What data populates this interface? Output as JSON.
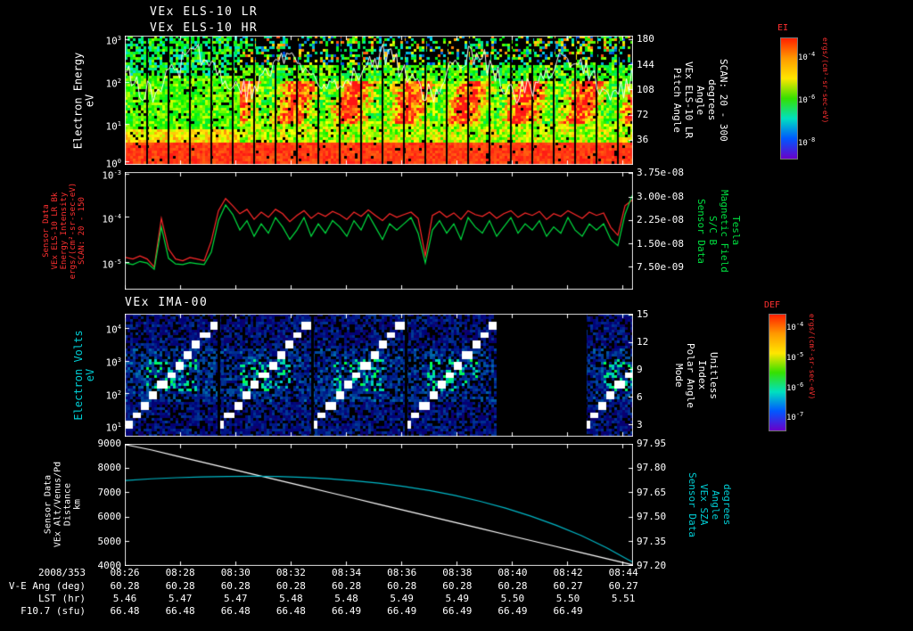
{
  "colors": {
    "bg": "#000000",
    "frame": "#dedede",
    "red": "#ff2a2a",
    "green": "#00e040",
    "cyan": "#00cdd4",
    "white": "#ffffff"
  },
  "time_axis": {
    "date": "2008/353",
    "labels": [
      "08:26",
      "08:28",
      "08:30",
      "08:32",
      "08:34",
      "08:36",
      "08:38",
      "08:40",
      "08:42",
      "08:44"
    ]
  },
  "ephemeris_rows": [
    {
      "label": "V-E Ang (deg)",
      "values": [
        "60.28",
        "60.28",
        "60.28",
        "60.28",
        "60.28",
        "60.28",
        "60.28",
        "60.28",
        "60.27",
        "60.27"
      ]
    },
    {
      "label": "LST (hr)",
      "values": [
        "5.46",
        "5.47",
        "5.47",
        "5.48",
        "5.48",
        "5.49",
        "5.49",
        "5.50",
        "5.50",
        "5.51"
      ]
    },
    {
      "label": "F10.7 (sfu)",
      "values": [
        "66.48",
        "66.48",
        "66.48",
        "66.48",
        "66.49",
        "66.49",
        "66.49",
        "66.49",
        "66.49"
      ]
    }
  ],
  "chart_data": [
    {
      "id": "els",
      "type": "heatmap",
      "titles": [
        "VEx ELS-10 LR",
        "VEx ELS-10 HR"
      ],
      "ylabel_left": [
        "Electron Energy",
        "eV"
      ],
      "ylabel_left_color": "#ffffff",
      "left_ticks": [
        {
          "label": "10^3",
          "f": 0.03
        },
        {
          "label": "10^2",
          "f": 0.36
        },
        {
          "label": "10^1",
          "f": 0.69
        },
        {
          "label": "10^0",
          "f": 0.98
        }
      ],
      "right_ticks": [
        {
          "label": "180",
          "f": 0.03
        },
        {
          "label": "144",
          "f": 0.225
        },
        {
          "label": "108",
          "f": 0.42
        },
        {
          "label": "72",
          "f": 0.615
        },
        {
          "label": "36",
          "f": 0.81
        }
      ],
      "ylabel_right": [
        "Pitch Angle",
        "VEx ELS-10 LR",
        "Angle",
        "degrees",
        "SCAN: 20 - 300"
      ],
      "ylabel_right_color": "#ffffff",
      "colorbar": {
        "label": "EI",
        "label_color": "#ff3030",
        "units": "ergs/(cm²-sr-sec-eV)",
        "units_color": "#ff3030",
        "ticks": [
          {
            "label": "10^-4",
            "f": 0.15
          },
          {
            "label": "10^-6",
            "f": 0.5
          },
          {
            "label": "10^-8",
            "f": 0.86
          }
        ],
        "gradient": [
          "#ff2000",
          "#ff9a00",
          "#ffe600",
          "#35e000",
          "#00e0c0",
          "#0058ff",
          "#6a00c8"
        ]
      },
      "content": {
        "kind": "els-spectrogram",
        "shock_frac": 0.225,
        "segments": 24,
        "overlay": "pitch-angle-trace",
        "overlay_color": "#ffffff"
      }
    },
    {
      "id": "intensity-bfield",
      "type": "line",
      "ylabel_left": [
        "Sensor Data",
        "VEx ELS-10 LR Bk",
        "Energy Intensity",
        "ergs/(cm²-sr-sec-eV)",
        "SCAN: 20 - 150"
      ],
      "ylabel_left_color": "#ff3030",
      "left_ticks": [
        {
          "label": "10^-3",
          "f": 0.015
        },
        {
          "label": "10^-4",
          "f": 0.385
        },
        {
          "label": "10^-5",
          "f": 0.77
        }
      ],
      "right_ticks": [
        {
          "label": "3.75e-08",
          "f": 0.01
        },
        {
          "label": "3.00e-08",
          "f": 0.21
        },
        {
          "label": "2.25e-08",
          "f": 0.41
        },
        {
          "label": "1.50e-08",
          "f": 0.61
        },
        {
          "label": "7.50e-09",
          "f": 0.81
        }
      ],
      "ylabel_right": [
        "Sensor Data",
        "S/C B",
        "Magnetic Field",
        "Tesla"
      ],
      "ylabel_right_color": "#00e040",
      "series": [
        {
          "name": "ELS energy intensity",
          "color": "#ff2a2a",
          "axis": "log-left",
          "axis_range": {
            "top": 0.001,
            "decade_frac": 0.385
          },
          "scale": 1e-06,
          "values": [
            13,
            12,
            14,
            12,
            8,
            95,
            20,
            12,
            11,
            13,
            12,
            11,
            30,
            140,
            260,
            180,
            120,
            150,
            90,
            130,
            100,
            150,
            120,
            80,
            110,
            140,
            95,
            125,
            105,
            135,
            115,
            90,
            130,
            105,
            145,
            110,
            85,
            120,
            100,
            115,
            130,
            95,
            14,
            110,
            135,
            100,
            125,
            90,
            140,
            115,
            105,
            130,
            95,
            120,
            140,
            100,
            125,
            110,
            135,
            90,
            120,
            105,
            140,
            115,
            95,
            130,
            110,
            125,
            60,
            40,
            180,
            240
          ]
        },
        {
          "name": "S/C B magnetic field",
          "color": "#00e040",
          "axis": "linear-right",
          "axis_range": {
            "top": 3.75e-08,
            "bottom": 0
          },
          "scale": 1e-09,
          "values": [
            8.5,
            8,
            9,
            8.5,
            6.5,
            20,
            10,
            8.2,
            8,
            8.6,
            8.3,
            8,
            12,
            22,
            27,
            24,
            19,
            22,
            17,
            21,
            18,
            23,
            20,
            16,
            19,
            23,
            17,
            21,
            18,
            22,
            20,
            17,
            22,
            19,
            24,
            20,
            16,
            21,
            19,
            21,
            23,
            18,
            8.5,
            19,
            22,
            18,
            21,
            16,
            23,
            20,
            18,
            22,
            17,
            20,
            23,
            18,
            21,
            19,
            22,
            17,
            20,
            18,
            23,
            19,
            17,
            21,
            19,
            21,
            16,
            14,
            24,
            30
          ]
        }
      ]
    },
    {
      "id": "ima",
      "type": "heatmap",
      "titles": [
        "VEx IMA-00"
      ],
      "ylabel_left": [
        "Electron Volts",
        "eV"
      ],
      "ylabel_left_color": "#00cdd4",
      "left_ticks": [
        {
          "label": "10^4",
          "f": 0.116
        },
        {
          "label": "10^3",
          "f": 0.384
        },
        {
          "label": "10^2",
          "f": 0.652
        },
        {
          "label": "10^1",
          "f": 0.913
        }
      ],
      "right_ticks": [
        {
          "label": "15",
          "f": 0.005
        },
        {
          "label": "12",
          "f": 0.23
        },
        {
          "label": "9",
          "f": 0.455
        },
        {
          "label": "6",
          "f": 0.68
        },
        {
          "label": "3",
          "f": 0.905
        }
      ],
      "ylabel_right": [
        "Mode",
        "Polar Angle",
        "Index",
        "Unitless"
      ],
      "ylabel_right_color": "#ffffff",
      "colorbar": {
        "label": "DEF",
        "label_color": "#ff3030",
        "units": "ergs/(cm²-sr-sec-eV)",
        "units_color": "#ff3030",
        "ticks": [
          {
            "label": "10^-4",
            "f": 0.1
          },
          {
            "label": "10^-5",
            "f": 0.36
          },
          {
            "label": "10^-6",
            "f": 0.62
          },
          {
            "label": "10^-7",
            "f": 0.88
          }
        ],
        "gradient": [
          "#ff2000",
          "#ff9a00",
          "#ffe600",
          "#35e000",
          "#00e0c0",
          "#0058ff",
          "#6a00c8"
        ]
      },
      "content": {
        "kind": "ima-spectrogram",
        "segment_starts": [
          0,
          0.184,
          0.368,
          0.553,
          0.905
        ],
        "segment_width": 0.18,
        "gap": [
          0.735,
          0.905
        ],
        "overlay": "elevation-scan-lines",
        "overlay_color": "#ffffff"
      }
    },
    {
      "id": "altitude-sza",
      "type": "line",
      "ylabel_left": [
        "Sensor Data",
        "VEx Alt/Venus/Pd",
        "Distance",
        "km"
      ],
      "ylabel_left_color": "#ffffff",
      "left_ticks": [
        {
          "label": "9000",
          "f": 0.0
        },
        {
          "label": "8000",
          "f": 0.2
        },
        {
          "label": "7000",
          "f": 0.4
        },
        {
          "label": "6000",
          "f": 0.6
        },
        {
          "label": "5000",
          "f": 0.8
        },
        {
          "label": "4000",
          "f": 1.0
        }
      ],
      "right_ticks": [
        {
          "label": "97.95",
          "f": 0.0
        },
        {
          "label": "97.80",
          "f": 0.2
        },
        {
          "label": "97.65",
          "f": 0.4
        },
        {
          "label": "97.50",
          "f": 0.6
        },
        {
          "label": "97.35",
          "f": 0.8
        },
        {
          "label": "97.20",
          "f": 1.0
        }
      ],
      "ylabel_right": [
        "Sensor Data",
        "VEx SZA",
        "Angle",
        "degrees"
      ],
      "ylabel_right_color": "#00cdd4",
      "series": [
        {
          "name": "VEx altitude",
          "color": "#ffffff",
          "axis": "linear-left",
          "axis_range": {
            "top": 9000,
            "bottom": 4000
          },
          "values": [
            9000,
            8753,
            8505,
            8258,
            8010,
            7763,
            7515,
            7268,
            7020,
            6773,
            6525,
            6278,
            6030,
            5783,
            5535,
            5288,
            5040,
            4793,
            4545,
            4298,
            4050
          ]
        },
        {
          "name": "VEx solar zenith angle",
          "color": "#00b8c8",
          "axis": "linear-right",
          "axis_range": {
            "top": 97.95,
            "bottom": 97.2
          },
          "values": [
            97.725,
            97.735,
            97.742,
            97.747,
            97.75,
            97.751,
            97.749,
            97.744,
            97.736,
            97.724,
            97.708,
            97.688,
            97.663,
            97.633,
            97.597,
            97.555,
            97.506,
            97.45,
            97.386,
            97.311,
            97.225
          ]
        }
      ]
    }
  ]
}
